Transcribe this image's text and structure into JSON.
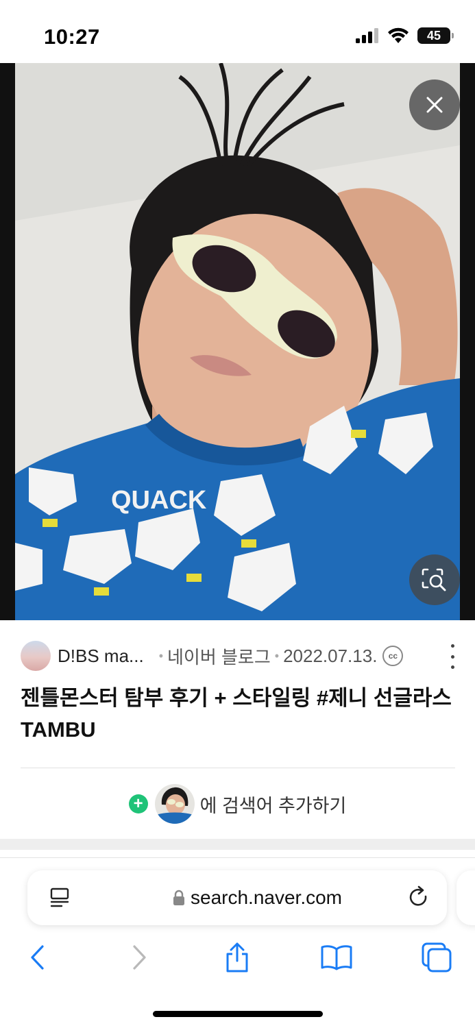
{
  "status_bar": {
    "time": "10:27",
    "battery": "45"
  },
  "result": {
    "source_name": "D!BS ma...",
    "platform": "네이버 블로그",
    "date": "2022.07.13.",
    "license_badge": "cc",
    "title": "젠틀몬스터 탐부 후기 + 스타일링 #제니 선글라스 TAMBU",
    "sweater_text": "QUACK"
  },
  "add_search": {
    "label": "에 검색어 추가하기"
  },
  "browser": {
    "url": "search.naver.com"
  },
  "icons": [
    "wifi-icon",
    "signal-icon",
    "close-icon",
    "lens-search-icon",
    "more-icon",
    "add-icon",
    "reader-icon",
    "lock-icon",
    "reload-icon",
    "back-icon",
    "forward-icon",
    "share-icon",
    "bookmarks-icon",
    "tabs-icon"
  ],
  "colors": {
    "accent_green": "#1fc378",
    "ios_blue": "#1a7cf5",
    "sweater_blue": "#1f6bb8"
  }
}
